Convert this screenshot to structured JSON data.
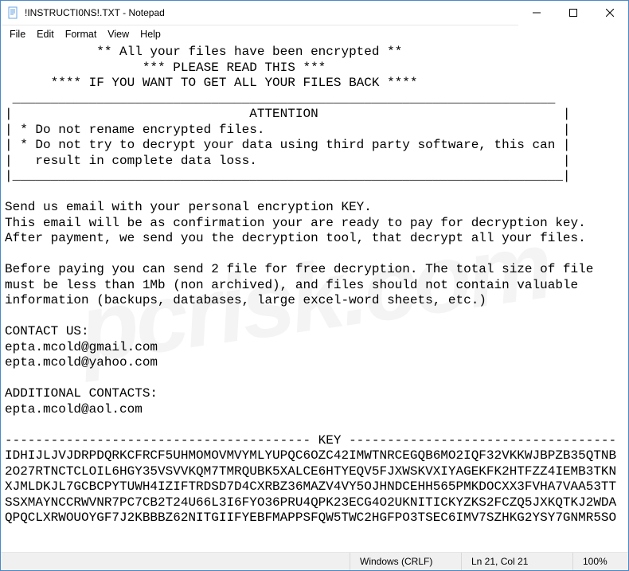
{
  "window": {
    "title": "!INSTRUCTI0NS!.TXT - Notepad",
    "icon": "notepad-file-icon"
  },
  "menu": {
    "items": [
      "File",
      "Edit",
      "Format",
      "View",
      "Help"
    ]
  },
  "editor": {
    "content": "            ** All your files have been encrypted **\n                  *** PLEASE READ THIS ***\n      **** IF YOU WANT TO GET ALL YOUR FILES BACK ****\n _______________________________________________________________________\n|                               ATTENTION                                |\n| * Do not rename encrypted files.                                       |\n| * Do not try to decrypt your data using third party software, this can |\n|   result in complete data loss.                                        |\n|________________________________________________________________________|\n\nSend us email with your personal encryption KEY.\nThis email will be as confirmation your are ready to pay for decryption key.\nAfter payment, we send you the decryption tool, that decrypt all your files.\n\nBefore paying you can send 2 file for free decryption. The total size of file\nmust be less than 1Mb (non archived), and files should not contain valuable\ninformation (backups, databases, large excel-word sheets, etc.)\n\nCONTACT US:\nepta.mcold@gmail.com\nepta.mcold@yahoo.com\n\nADDITIONAL CONTACTS:\nepta.mcold@aol.com\n\n---------------------------------------- KEY -----------------------------------\nIDHIJLJVJDRPDQRKCFRCF5UHMOMOVMVYMLYUPQC6OZC42IMWTNRCEGQB6MO2IQF32VKKWJBPZB35QTNB\n2O27RTNCTCLOIL6HGY35VSVVKQM7TMRQUBK5XALCE6HTYEQV5FJXWSKVXIYAGEKFK2HTFZZ4IEMB3TKN\nXJMLDKJL7GCBCPYTUWH4IZIFTRDSD7D4CXRBZ36MAZV4VY5OJHNDCEHH565PMKDOCXX3FVHA7VAA53TT\nSSXMAYNCCRWVNR7PC7CB2T24U66L3I6FYO36PRU4QPK23ECG4O2UKNITICKYZKS2FCZQ5JXKQTKJ2WDA\nQPQCLXRWOUOYGF7J2KBBBZ62NITGIIFYEBFMAPPSFQW5TWC2HGFPO3TSEC6IMV7SZHKG2YSY7GNMR5SO"
  },
  "status": {
    "encoding": "Windows (CRLF)",
    "position": "Ln 21, Col 21",
    "zoom": "100%"
  },
  "watermark": "pcrisk.com"
}
